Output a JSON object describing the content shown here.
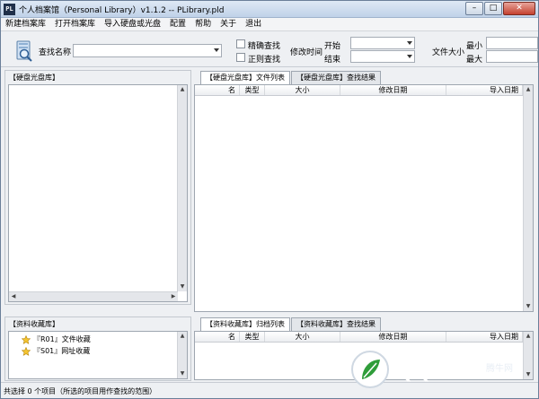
{
  "window": {
    "app_icon_text": "PL",
    "title": "个人档案馆（Personal Library）v1.1.2 -- PLibrary.pld",
    "minimize_glyph": "–",
    "maximize_glyph": "□",
    "close_glyph": "✕"
  },
  "menu": [
    "新建档案库",
    "打开档案库",
    "导入硬盘或光盘",
    "配置",
    "帮助",
    "关于",
    "退出"
  ],
  "search": {
    "name_label": "查找名称",
    "name_value": "",
    "exact_label": "精确查找",
    "regex_label": "正则查找",
    "exact_checked": false,
    "regex_checked": false,
    "modtime_label": "修改时间",
    "start_label": "开始",
    "end_label": "结束",
    "filesize_label": "文件大小",
    "min_label": "最小",
    "max_label": "最大"
  },
  "left_top_panel": {
    "header": "【硬盘光盘库】"
  },
  "left_bottom_panel": {
    "header": "【资料收藏库】",
    "items": [
      {
        "icon": "star-icon",
        "label": "『R01』文件收藏"
      },
      {
        "icon": "star-icon",
        "label": "『S01』网址收藏"
      }
    ]
  },
  "right_top": {
    "tabs": [
      "【硬盘光盘库】文件列表",
      "【硬盘光盘库】查找结果"
    ],
    "active_tab": 0,
    "columns": [
      "名",
      "类型",
      "大小",
      "修改日期",
      "导入日期"
    ]
  },
  "right_bottom": {
    "tabs": [
      "【资料收藏库】归档列表",
      "【资料收藏库】查找结果"
    ],
    "active_tab": 0,
    "columns": [
      "名",
      "类型",
      "大小",
      "修改日期",
      "导入日期"
    ]
  },
  "status": {
    "text": "共选择 0 个项目（所选的项目用作查找的范围）"
  },
  "watermark": {
    "brand": "QQTN",
    "suffix": ".com",
    "tagline": "腾牛网"
  }
}
